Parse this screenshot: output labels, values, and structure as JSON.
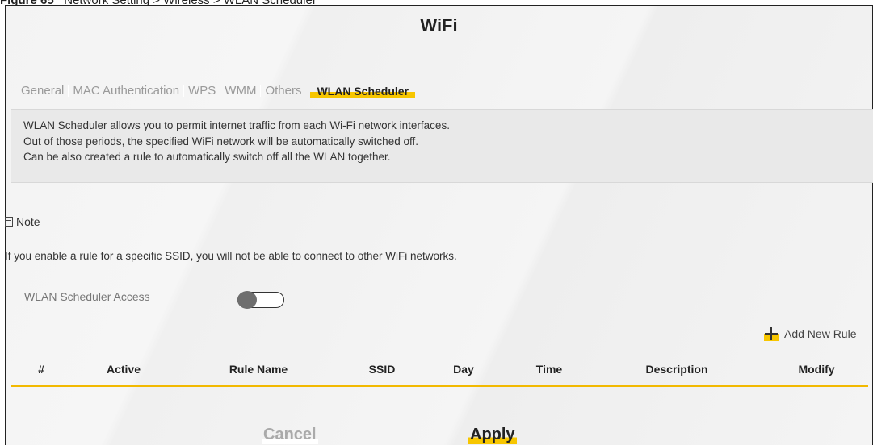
{
  "caption": {
    "figure": "Figure 65",
    "path": "Network Setting > Wireless > WLAN Scheduler"
  },
  "page": {
    "title": "WiFi"
  },
  "tabs": [
    {
      "label": "General",
      "active": false
    },
    {
      "label": "MAC Authentication",
      "active": false
    },
    {
      "label": "WPS",
      "active": false
    },
    {
      "label": "WMM",
      "active": false
    },
    {
      "label": "Others",
      "active": false
    },
    {
      "label": "WLAN Scheduler",
      "active": true
    }
  ],
  "info": {
    "line1": "WLAN Scheduler allows you to permit internet traffic from each Wi-Fi network interfaces.",
    "line2": "Out of those periods, the specified WiFi network will be automatically switched off.",
    "line3": "Can be also created a rule to automatically switch off all the WLAN together."
  },
  "note": {
    "title": "Note",
    "text": "If you enable a rule for a specific SSID, you will not be able to connect to other WiFi networks."
  },
  "scheduler": {
    "access_label": "WLAN Scheduler Access",
    "access_enabled": false
  },
  "add_rule": {
    "label": "Add New Rule",
    "icon": "plus-icon"
  },
  "table": {
    "columns": [
      "#",
      "Active",
      "Rule Name",
      "SSID",
      "Day",
      "Time",
      "Description",
      "Modify"
    ],
    "rows": []
  },
  "buttons": {
    "cancel": "Cancel",
    "apply": "Apply"
  },
  "colors": {
    "accent": "#f7c600",
    "table_rule": "#f2b900"
  }
}
